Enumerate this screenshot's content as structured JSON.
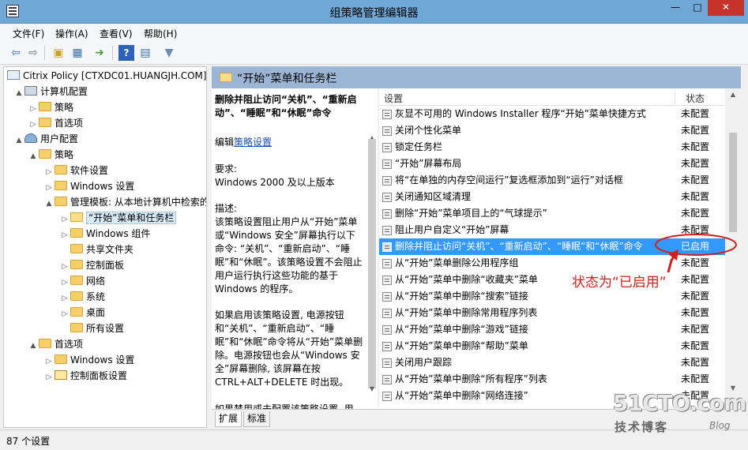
{
  "window": {
    "title": "组策略管理编辑器",
    "minimize": "—",
    "maximize": "□",
    "close": "✕"
  },
  "menu": [
    "文件(F)",
    "操作(A)",
    "查看(V)",
    "帮助(H)"
  ],
  "toolbar": {
    "icons": [
      "back-arrow-icon",
      "forward-arrow-icon",
      "up-folder-icon",
      "show-hide-tree-icon",
      "export-list-icon",
      "help-icon",
      "properties-icon",
      "filter-icon"
    ]
  },
  "tree": [
    {
      "label": "Citrix Policy [CTXDC01.HUANGJH.COM]",
      "icon": "policy"
    },
    {
      "label": "计算机配置",
      "icon": "computer",
      "expander": "▲"
    },
    {
      "label": "策略",
      "icon": "folder",
      "expander": "▷"
    },
    {
      "label": "首选项",
      "icon": "folder",
      "expander": "▷"
    },
    {
      "label": "用户配置",
      "icon": "user",
      "expander": "▲"
    },
    {
      "label": "策略",
      "icon": "folder",
      "expander": "▲"
    },
    {
      "label": "软件设置",
      "icon": "folder",
      "expander": "▷"
    },
    {
      "label": "Windows 设置",
      "icon": "folder",
      "expander": "▷"
    },
    {
      "label": "管理模板: 从本地计算机中检索的",
      "icon": "folder",
      "expander": "▲"
    },
    {
      "label": "“开始”菜单和任务栏",
      "icon": "folder-open",
      "expander": "▷",
      "selected": true
    },
    {
      "label": "Windows 组件",
      "icon": "folder",
      "expander": "▷"
    },
    {
      "label": "共享文件夹",
      "icon": "folder",
      "expander": ""
    },
    {
      "label": "控制面板",
      "icon": "folder",
      "expander": "▷"
    },
    {
      "label": "网络",
      "icon": "folder",
      "expander": "▷"
    },
    {
      "label": "系统",
      "icon": "folder",
      "expander": "▷"
    },
    {
      "label": "桌面",
      "icon": "folder",
      "expander": "▷"
    },
    {
      "label": "所有设置",
      "icon": "folder",
      "expander": ""
    },
    {
      "label": "首选项",
      "icon": "folder",
      "expander": "▲"
    },
    {
      "label": "Windows 设置",
      "icon": "folder",
      "expander": "▷"
    },
    {
      "label": "控制面板设置",
      "icon": "control-panel",
      "expander": "▷"
    }
  ],
  "right_header": "“开始”菜单和任务栏",
  "description": {
    "title": "删除并阻止访问“关机”、“重新启动”、“睡眠”和“休眠”命令",
    "edit_prefix": "编辑",
    "edit_link": "策略设置",
    "requirements_label": "要求:",
    "requirements_value": "Windows 2000 及以上版本",
    "desc_label": "描述:",
    "desc_text": "该策略设置阻止用户从“开始”菜单或“Windows 安全”屏幕执行以下命令: “关机”、“重新启动”、“睡眠”和“休眠”。该策略设置不会阻止用户运行执行这些功能的基于 Windows 的程序。",
    "desc_text2": "如果启用该策略设置, 电源按钮和“关机”、“重新启动”、“睡眠”和“休眠”命令将从“开始”菜单删除。电源按钮也会从“Windows 安全”屏幕删除, 该屏幕在按 CTRL+ALT+DELETE 时出现。",
    "desc_text3": "如果禁用或未配置该策略设置, 用"
  },
  "list": {
    "col_setting": "设置",
    "col_state": "状态",
    "rows": [
      {
        "name": "灰显不可用的 Windows Installer 程序“开始”菜单快捷方式",
        "state": "未配置"
      },
      {
        "name": "关闭个性化菜单",
        "state": "未配置"
      },
      {
        "name": "锁定任务栏",
        "state": "未配置"
      },
      {
        "name": "“开始”屏幕布局",
        "state": "未配置"
      },
      {
        "name": "将“在单独的内存空间运行”复选框添加到“运行”对话框",
        "state": "未配置"
      },
      {
        "name": "关闭通知区域清理",
        "state": "未配置"
      },
      {
        "name": "删除“开始”菜单项目上的“气球提示”",
        "state": "未配置"
      },
      {
        "name": "阻止用户自定义“开始”屏幕",
        "state": "未配置"
      },
      {
        "name": "删除并阻止访问“关机”、“重新启动”、“睡眠”和“休眠”命令",
        "state": "已启用",
        "selected": true
      },
      {
        "name": "从“开始”菜单删除公用程序组",
        "state": "未配置"
      },
      {
        "name": "从“开始”菜单中删除“收藏夹”菜单",
        "state": "未配置"
      },
      {
        "name": "从“开始”菜单中删除“搜索”链接",
        "state": "未配置"
      },
      {
        "name": "从“开始”菜单中删除常用程序列表",
        "state": "未配置"
      },
      {
        "name": "从“开始”菜单中删除“游戏”链接",
        "state": "未配置"
      },
      {
        "name": "从“开始”菜单中删除“帮助”菜单",
        "state": "未配置"
      },
      {
        "name": "关闭用户跟踪",
        "state": "未配置"
      },
      {
        "name": "从“开始”菜单中删除“所有程序”列表",
        "state": "未配置"
      },
      {
        "name": "从“开始”菜单中删除“网络连接”",
        "state": "未配置"
      }
    ]
  },
  "tabs": [
    "扩展",
    "标准"
  ],
  "status_bar": "87 个设置",
  "annotation": {
    "text": "状态为“已启用”",
    "color": "#d0201c"
  },
  "watermark": {
    "logo": "51CTO.com",
    "sub": "技术博客",
    "blog": "Blog"
  },
  "colors": {
    "title_bar": "#6fa7d6",
    "selection": "#3399ff",
    "header": "#9bb6d4"
  }
}
